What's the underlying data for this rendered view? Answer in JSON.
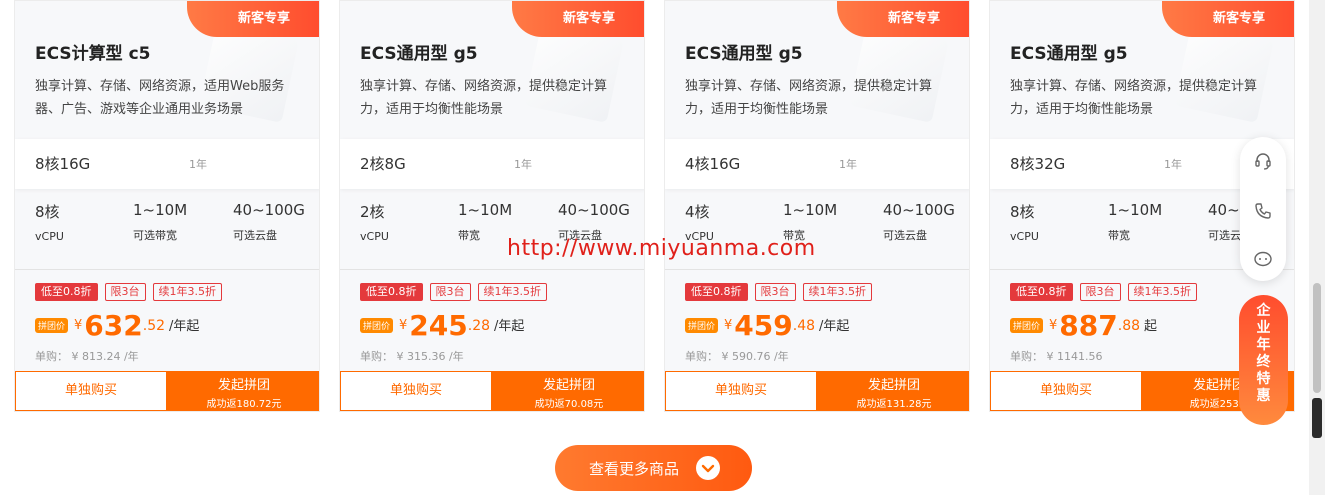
{
  "cards": [
    {
      "badge": "新客专享",
      "title": "ECS计算型 c5",
      "desc": "独享计算、存储、网络资源，适用Web服务器、广告、游戏等企业通用业务场景",
      "config": "8核16G",
      "term": "1年",
      "params": [
        {
          "value": "8核",
          "label": "vCPU"
        },
        {
          "value": "1~10M",
          "label": "可选带宽"
        },
        {
          "value": "40~100G",
          "label": "可选云盘"
        }
      ],
      "tags": [
        "低至0.8折",
        "限3台",
        "续1年3.5折"
      ],
      "price_tag": "拼团价",
      "currency": "¥",
      "price_int": "632",
      "price_dec": ".52",
      "unit": "/年起",
      "single_price": "单购：  ¥ 813.24 /年",
      "btn_single": "单独购买",
      "btn_group": "发起拼团",
      "btn_group_sub": "成功返180.72元"
    },
    {
      "badge": "新客专享",
      "title": "ECS通用型 g5",
      "desc": "独享计算、存储、网络资源，提供稳定计算力，适用于均衡性能场景",
      "config": "2核8G",
      "term": "1年",
      "params": [
        {
          "value": "2核",
          "label": "vCPU"
        },
        {
          "value": "1~10M",
          "label": "带宽"
        },
        {
          "value": "40~100G",
          "label": "可选云盘"
        }
      ],
      "tags": [
        "低至0.8折",
        "限3台",
        "续1年3.5折"
      ],
      "price_tag": "拼团价",
      "currency": "¥",
      "price_int": "245",
      "price_dec": ".28",
      "unit": "/年起",
      "single_price": "单购：  ¥ 315.36 /年",
      "btn_single": "单独购买",
      "btn_group": "发起拼团",
      "btn_group_sub": "成功返70.08元"
    },
    {
      "badge": "新客专享",
      "title": "ECS通用型 g5",
      "desc": "独享计算、存储、网络资源，提供稳定计算力，适用于均衡性能场景",
      "config": "4核16G",
      "term": "1年",
      "params": [
        {
          "value": "4核",
          "label": "vCPU"
        },
        {
          "value": "1~10M",
          "label": "带宽"
        },
        {
          "value": "40~100G",
          "label": "可选云盘"
        }
      ],
      "tags": [
        "低至0.8折",
        "限3台",
        "续1年3.5折"
      ],
      "price_tag": "拼团价",
      "currency": "¥",
      "price_int": "459",
      "price_dec": ".48",
      "unit": "/年起",
      "single_price": "单购：  ¥ 590.76 /年",
      "btn_single": "单独购买",
      "btn_group": "发起拼团",
      "btn_group_sub": "成功返131.28元"
    },
    {
      "badge": "新客专享",
      "title": "ECS通用型 g5",
      "desc": "独享计算、存储、网络资源，提供稳定计算力，适用于均衡性能场景",
      "config": "8核32G",
      "term": "1年",
      "params": [
        {
          "value": "8核",
          "label": "vCPU"
        },
        {
          "value": "1~10M",
          "label": "带宽"
        },
        {
          "value": "40~1",
          "label": "可选云"
        }
      ],
      "tags": [
        "低至0.8折",
        "限3台",
        "续1年3.5折"
      ],
      "price_tag": "拼团价",
      "currency": "¥",
      "price_int": "887",
      "price_dec": ".88",
      "unit": "起",
      "single_price": "单购：  ¥ 1141.56",
      "btn_single": "单独购买",
      "btn_group": "发起拼团",
      "btn_group_sub": "成功返253.6"
    }
  ],
  "more_button": {
    "label": "查看更多商品",
    "icon": "chevron-down-icon"
  },
  "watermark": "http://www.miyuanma.com",
  "side_tools": [
    {
      "icon": "headset-icon"
    },
    {
      "icon": "phone-icon"
    },
    {
      "icon": "chat-icon"
    }
  ],
  "promo": {
    "label": "企业年终特惠"
  },
  "colors": {
    "accent": "#ff6a00",
    "tag_red": "#e4393c",
    "badge": "#ff4d2e"
  }
}
